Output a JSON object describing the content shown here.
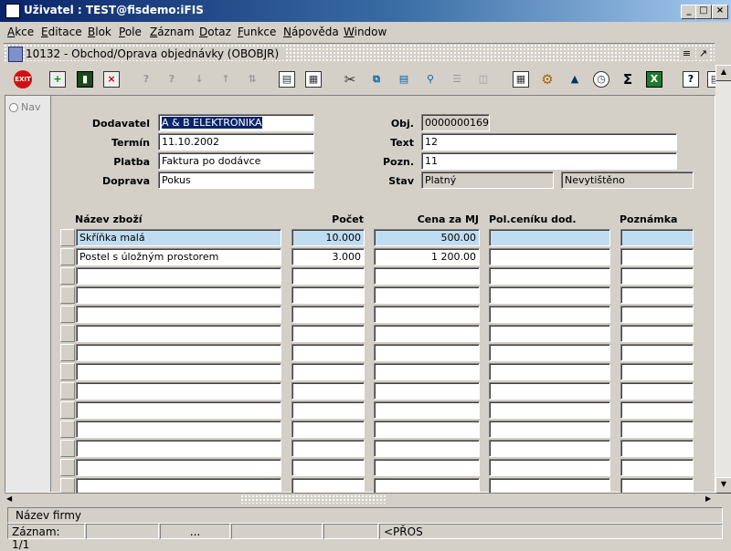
{
  "window": {
    "title": "Uživatel : TEST@fisdemo:iFIS",
    "min_glyph": "_",
    "max_glyph": "□",
    "close_glyph": "×"
  },
  "menu": [
    "Akce",
    "Editace",
    "Blok",
    "Pole",
    "Záznam",
    "Dotaz",
    "Funkce",
    "Nápověda",
    "Window"
  ],
  "inner_window": {
    "title": "10132 - Obchod/Oprava objednávky (OBOBJR)"
  },
  "toolbar": {
    "exit_label": "EXIT",
    "icons": [
      "exit-icon",
      "new-record-icon",
      "save-icon",
      "delete-record-icon",
      "query-enter-icon",
      "query-execute-icon",
      "sort-asc-icon",
      "sort-desc-icon",
      "filter-icon",
      "print-icon",
      "print-preview-icon",
      "cut-icon",
      "copy-icon",
      "paste-icon",
      "find-icon",
      "list-icon",
      "columns-icon",
      "calculator-icon",
      "settings-icon",
      "chart-icon",
      "clock-icon",
      "sum-icon",
      "excel-icon",
      "help-icon",
      "info-icon"
    ]
  },
  "nav": {
    "label": "Nav"
  },
  "header_form": {
    "dodavatel_label": "Dodavatel",
    "dodavatel_value": "A & B ELEKTRONIKA",
    "termin_label": "Termín",
    "termin_value": "11.10.2002",
    "platba_label": "Platba",
    "platba_value": "Faktura po dodávce",
    "doprava_label": "Doprava",
    "doprava_value": "Pokus",
    "obj_label": "Obj.",
    "obj_value": "0000000169",
    "text_label": "Text",
    "text_value": "12",
    "pozn_label": "Pozn.",
    "pozn_value": "11",
    "stav_label": "Stav",
    "stav_value": "Platný",
    "stav2_value": "Nevytištěno"
  },
  "items_table": {
    "columns": [
      "Název zboží",
      "Počet",
      "Cena za MJ",
      "Pol.ceníku dod.",
      "Poznámka"
    ],
    "rows": [
      [
        "Skříňka malá",
        "10.000",
        "500.00",
        "",
        ""
      ],
      [
        "Postel s úložným prostorem",
        "3.000",
        "1 200.00",
        "",
        ""
      ],
      [
        "",
        "",
        "",
        "",
        ""
      ],
      [
        "",
        "",
        "",
        "",
        ""
      ],
      [
        "",
        "",
        "",
        "",
        ""
      ],
      [
        "",
        "",
        "",
        "",
        ""
      ],
      [
        "",
        "",
        "",
        "",
        ""
      ],
      [
        "",
        "",
        "",
        "",
        ""
      ],
      [
        "",
        "",
        "",
        "",
        ""
      ],
      [
        "",
        "",
        "",
        "",
        ""
      ],
      [
        "",
        "",
        "",
        "",
        ""
      ],
      [
        "",
        "",
        "",
        "",
        ""
      ],
      [
        "",
        "",
        "",
        "",
        ""
      ],
      [
        "",
        "",
        "",
        "",
        ""
      ]
    ]
  },
  "hint": "Název firmy",
  "status": {
    "record": "Záznam: 1/1",
    "ellipsis": "...",
    "mode": "<PŘOS"
  }
}
